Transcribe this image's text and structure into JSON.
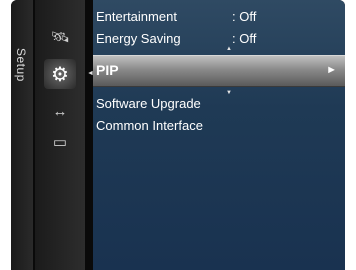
{
  "side_tab": {
    "label": "Setup"
  },
  "icons": [
    {
      "name": "satellite-icon",
      "glyph": "🛰"
    },
    {
      "name": "gear-icon",
      "glyph": "⚙"
    },
    {
      "name": "input-icon",
      "glyph": "↔"
    },
    {
      "name": "application-icon",
      "glyph": "▭"
    }
  ],
  "menu": {
    "items": [
      {
        "label": "Entertainment",
        "value": ": Off"
      },
      {
        "label": "Energy Saving",
        "value": ": Off"
      },
      {
        "label": "PIP",
        "value": "",
        "arrow": "►"
      },
      {
        "label": "Software Upgrade",
        "value": ""
      },
      {
        "label": "Common Interface",
        "value": ""
      }
    ],
    "scroll_up": "▲",
    "scroll_down": "▼",
    "selection_pointer": "◄"
  }
}
